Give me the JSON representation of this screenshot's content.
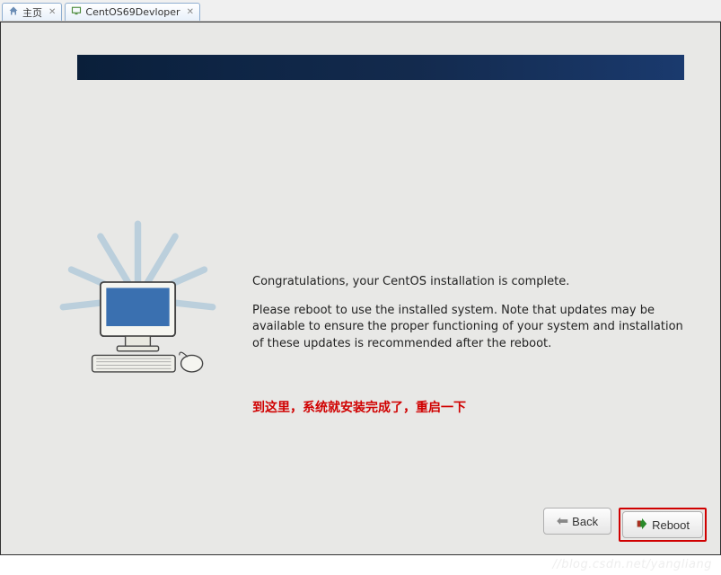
{
  "tabs": {
    "home": {
      "label": "主页"
    },
    "vm": {
      "label": "CentOS69Devloper"
    }
  },
  "installer": {
    "congrats": "Congratulations, your CentOS installation is complete.",
    "reboot_note": "Please reboot to use the installed system.  Note that updates may be available to ensure the proper functioning of your system and installation of these updates is recommended after the reboot.",
    "annotation": "到这里，系统就安装完成了，重启一下",
    "buttons": {
      "back": "Back",
      "reboot": "Reboot"
    }
  },
  "watermark": "//blog.csdn.net/yangliang"
}
